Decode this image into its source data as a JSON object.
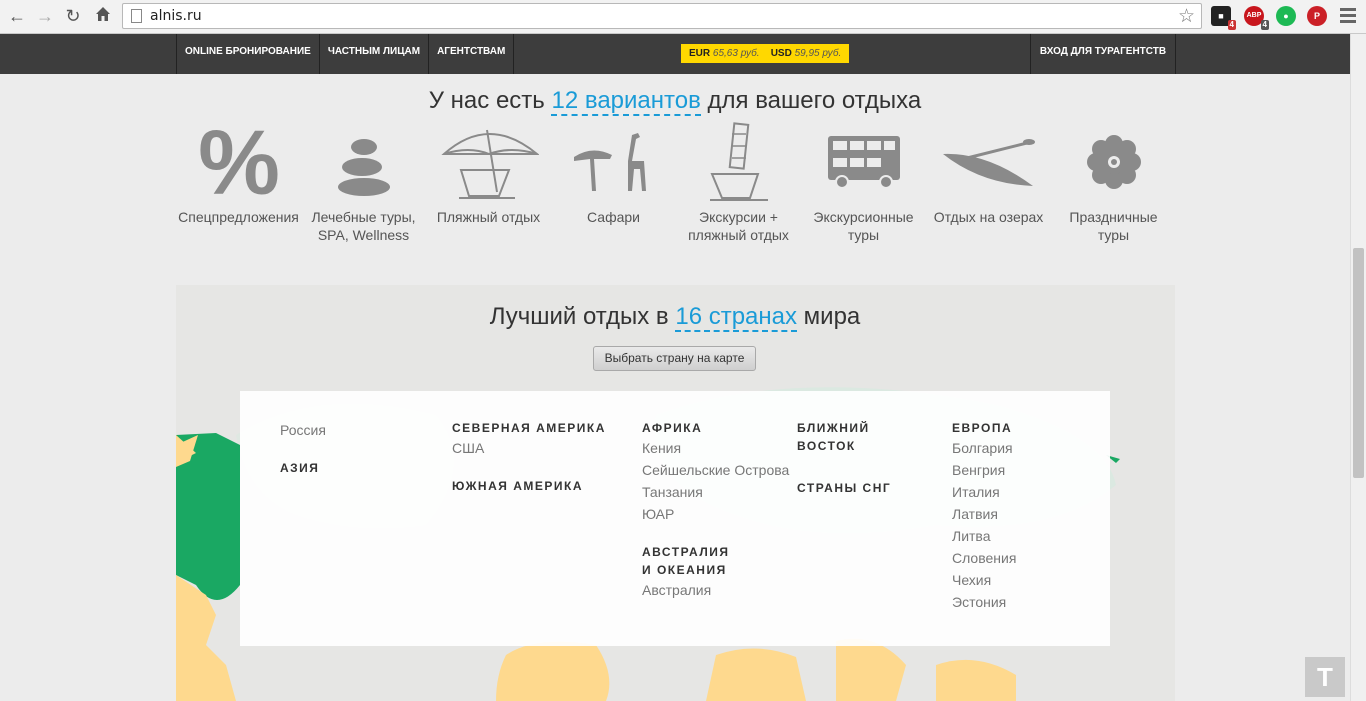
{
  "browser": {
    "url": "alnis.ru",
    "ext_badges": [
      "4",
      "4"
    ],
    "ext2_label": "ABP"
  },
  "topbar": {
    "nav": [
      "ONLINE БРОНИРОВАНИЕ",
      "ЧАСТНЫМ ЛИЦАМ",
      "АГЕНТСТВАМ"
    ],
    "currency": {
      "eur_label": "EUR",
      "eur_rate": "65,63 руб.",
      "usd_label": "USD",
      "usd_rate": "59,95 руб."
    },
    "agent_login": "ВХОД ДЛЯ ТУРАГЕНТСТВ"
  },
  "variants": {
    "title_before": "У нас есть",
    "title_highlight": "12 вариантов",
    "title_after": "для вашего отдыха",
    "categories": [
      {
        "icon": "percent-icon",
        "line1": "Спецпредложения",
        "line2": ""
      },
      {
        "icon": "spa-stones-icon",
        "line1": "Лечебные туры,",
        "line2": "SPA, Wellness"
      },
      {
        "icon": "beach-umbrella-icon",
        "line1": "Пляжный отдых",
        "line2": ""
      },
      {
        "icon": "safari-giraffe-icon",
        "line1": "Сафари",
        "line2": ""
      },
      {
        "icon": "tower-beach-icon",
        "line1": "Экскурсии +",
        "line2": "пляжный отдых"
      },
      {
        "icon": "double-decker-bus-icon",
        "line1": "Экскурсионные",
        "line2": "туры"
      },
      {
        "icon": "canoe-icon",
        "line1": "Отдых на озерах",
        "line2": ""
      },
      {
        "icon": "flower-icon",
        "line1": "Праздничные",
        "line2": "туры"
      }
    ]
  },
  "countries": {
    "title_before": "Лучший отдых в",
    "title_highlight": "16 странах",
    "title_after": "мира",
    "map_button": "Выбрать страну на карте",
    "col1": {
      "russia": "Россия",
      "asia": "АЗИЯ"
    },
    "col2": {
      "north_america": "СЕВЕРНАЯ АМЕРИКА",
      "usa": "США",
      "south_america": "ЮЖНАЯ АМЕРИКА"
    },
    "col3": {
      "africa": "АФРИКА",
      "africa_countries": [
        "Кения",
        "Сейшельские Острова",
        "Танзания",
        "ЮАР"
      ],
      "australia_line1": "АВСТРАЛИЯ",
      "australia_line2": "И ОКЕАНИЯ",
      "australia_countries": [
        "Австралия"
      ]
    },
    "col4": {
      "near_east_line1": "БЛИЖНИЙ",
      "near_east_line2": "ВОСТОК",
      "cis": "СТРАНЫ СНГ"
    },
    "col5": {
      "europe": "ЕВРОПА",
      "europe_countries": [
        "Болгария",
        "Венгрия",
        "Италия",
        "Латвия",
        "Литва",
        "Словения",
        "Чехия",
        "Эстония"
      ]
    }
  },
  "totop_label": "T",
  "colors": {
    "accent": "#1a9bd7",
    "currency_bg": "#ffd800",
    "topbar": "#3d3d3d",
    "map_land": "#fed98e",
    "map_green": "#1aa863"
  }
}
